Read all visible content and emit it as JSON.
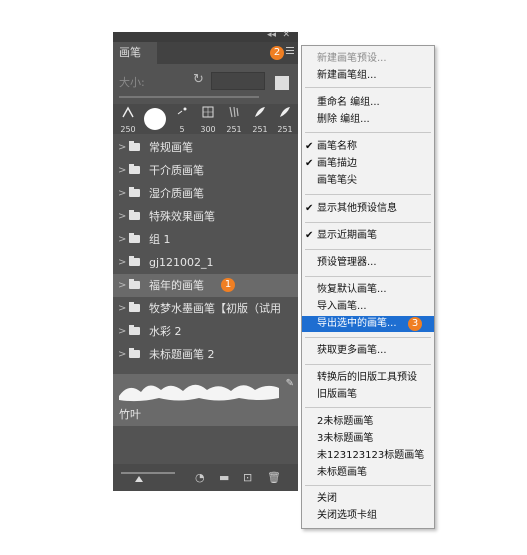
{
  "panel": {
    "tab_label": "画笔",
    "size_label": "大小:",
    "badge_menu": "2",
    "presets": [
      {
        "num": "250",
        "icon": "brush-tip-icon"
      },
      {
        "num": "",
        "icon": "round-brush-icon"
      },
      {
        "num": "5",
        "icon": "small-brush-icon"
      },
      {
        "num": "300",
        "icon": "square-brush-icon"
      },
      {
        "num": "251",
        "icon": "brush-tip-icon"
      },
      {
        "num": "251",
        "icon": "leaf-brush-icon"
      },
      {
        "num": "251",
        "icon": "leaf-brush-icon"
      }
    ],
    "folders": [
      {
        "label": "常规画笔"
      },
      {
        "label": "干介质画笔"
      },
      {
        "label": "湿介质画笔"
      },
      {
        "label": "特殊效果画笔"
      },
      {
        "label": "组 1"
      },
      {
        "label": "gj121002_1"
      },
      {
        "label": "福年的画笔",
        "badge": "1"
      },
      {
        "label": "牧梦水墨画笔【初版（试用"
      },
      {
        "label": "水彩 2"
      },
      {
        "label": "未标题画笔 2"
      }
    ],
    "brush_item_label": "竹叶"
  },
  "menu": {
    "badge_export": "3",
    "items": [
      {
        "label": "新建画笔预设...",
        "disabled": true
      },
      {
        "label": "新建画笔组..."
      },
      {
        "label": "重命名 编组..."
      },
      {
        "label": "删除 编组..."
      },
      {
        "label": "画笔名称",
        "checked": "✔"
      },
      {
        "label": "画笔描边",
        "checked": "✔"
      },
      {
        "label": "画笔笔尖"
      },
      {
        "label": "显示其他预设信息",
        "checked": "✔"
      },
      {
        "label": "显示近期画笔",
        "checked": "✔"
      },
      {
        "label": "预设管理器..."
      },
      {
        "label": "恢复默认画笔..."
      },
      {
        "label": "导入画笔..."
      },
      {
        "label": "导出选中的画笔...",
        "highlighted": true
      },
      {
        "label": "获取更多画笔..."
      },
      {
        "label": "转换后的旧版工具预设"
      },
      {
        "label": "旧版画笔"
      },
      {
        "label": "2未标题画笔"
      },
      {
        "label": "3未标题画笔"
      },
      {
        "label": "未123123123标题画笔"
      },
      {
        "label": "未标题画笔"
      },
      {
        "label": "关闭"
      },
      {
        "label": "关闭选项卡组"
      }
    ]
  },
  "colors": {
    "panel_bg": "#535353",
    "selection_bg": "#6a6a6a",
    "badge": "#f07f23",
    "menu_highlight": "#1e6ed1"
  }
}
